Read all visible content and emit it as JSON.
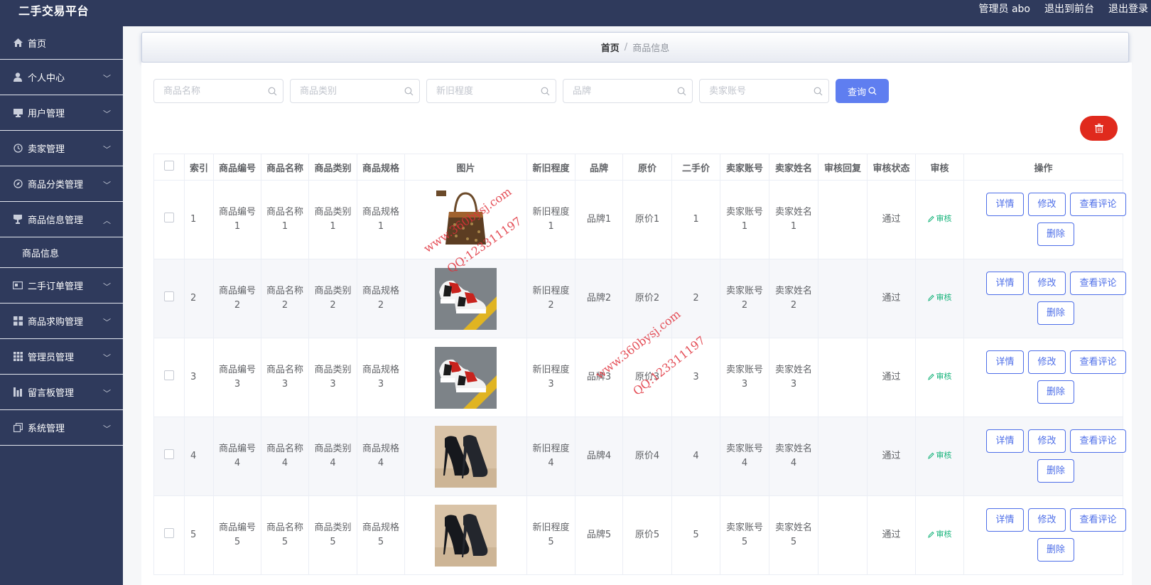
{
  "app": {
    "title": "二手交易平台",
    "admin_label": "管理员 abo",
    "back_to_front": "退出到前台",
    "logout": "退出登录"
  },
  "sidebar": {
    "items": [
      {
        "label": "首页",
        "icon": "home-icon"
      },
      {
        "label": "个人中心",
        "icon": "user-icon"
      },
      {
        "label": "用户管理",
        "icon": "monitor-icon"
      },
      {
        "label": "卖家管理",
        "icon": "clock-icon"
      },
      {
        "label": "商品分类管理",
        "icon": "compass-icon"
      },
      {
        "label": "商品信息管理",
        "icon": "cup-icon"
      },
      {
        "label": "二手订单管理",
        "icon": "card-icon"
      },
      {
        "label": "商品求购管理",
        "icon": "grid-icon"
      },
      {
        "label": "管理员管理",
        "icon": "apps-icon"
      },
      {
        "label": "留言板管理",
        "icon": "bars-icon"
      },
      {
        "label": "系统管理",
        "icon": "copy-icon"
      }
    ],
    "sub_item": "商品信息"
  },
  "breadcrumb": {
    "home": "首页",
    "separator": "/",
    "current": "商品信息"
  },
  "search": {
    "name_placeholder": "商品名称",
    "category_placeholder": "商品类别",
    "condition_placeholder": "新旧程度",
    "brand_placeholder": "品牌",
    "seller_placeholder": "卖家账号",
    "query_label": "查询"
  },
  "table": {
    "headers": [
      "索引",
      "商品编号",
      "商品名称",
      "商品类别",
      "商品规格",
      "图片",
      "新旧程度",
      "品牌",
      "原价",
      "二手价",
      "卖家账号",
      "卖家姓名",
      "审核回复",
      "审核状态",
      "审核",
      "操作"
    ],
    "rows": [
      {
        "index": "1",
        "code": "商品编号1",
        "name": "商品名称1",
        "category": "商品类别1",
        "spec": "商品规格1",
        "image": "handbag",
        "condition": "新旧程度1",
        "brand": "品牌1",
        "orig": "原价1",
        "price": "1",
        "seller_acc": "卖家账号1",
        "seller_name": "卖家姓名1",
        "reply": "",
        "status": "通过"
      },
      {
        "index": "2",
        "code": "商品编号2",
        "name": "商品名称2",
        "category": "商品类别2",
        "spec": "商品规格2",
        "image": "sneakers",
        "condition": "新旧程度2",
        "brand": "品牌2",
        "orig": "原价2",
        "price": "2",
        "seller_acc": "卖家账号2",
        "seller_name": "卖家姓名2",
        "reply": "",
        "status": "通过"
      },
      {
        "index": "3",
        "code": "商品编号3",
        "name": "商品名称3",
        "category": "商品类别3",
        "spec": "商品规格3",
        "image": "sneakers",
        "condition": "新旧程度3",
        "brand": "品牌3",
        "orig": "原价3",
        "price": "3",
        "seller_acc": "卖家账号3",
        "seller_name": "卖家姓名3",
        "reply": "",
        "status": "通过"
      },
      {
        "index": "4",
        "code": "商品编号4",
        "name": "商品名称4",
        "category": "商品类别4",
        "spec": "商品规格4",
        "image": "heels",
        "condition": "新旧程度4",
        "brand": "品牌4",
        "orig": "原价4",
        "price": "4",
        "seller_acc": "卖家账号4",
        "seller_name": "卖家姓名4",
        "reply": "",
        "status": "通过"
      },
      {
        "index": "5",
        "code": "商品编号5",
        "name": "商品名称5",
        "category": "商品类别5",
        "spec": "商品规格5",
        "image": "heels",
        "condition": "新旧程度5",
        "brand": "品牌5",
        "orig": "原价5",
        "price": "5",
        "seller_acc": "卖家账号5",
        "seller_name": "卖家姓名5",
        "reply": "",
        "status": "通过"
      }
    ],
    "audit_label": "审核",
    "actions": {
      "detail": "详情",
      "edit": "修改",
      "review": "查看评论",
      "delete": "删除"
    }
  },
  "watermarks": [
    "www.360bysj.com",
    "QQ:123311197",
    "www.360bysj.com",
    "QQ:123311197"
  ],
  "colors": {
    "sidebar": "#2f3a5c",
    "primary": "#5f7ef0",
    "danger": "#e02a1d",
    "audit": "#16b37a"
  }
}
